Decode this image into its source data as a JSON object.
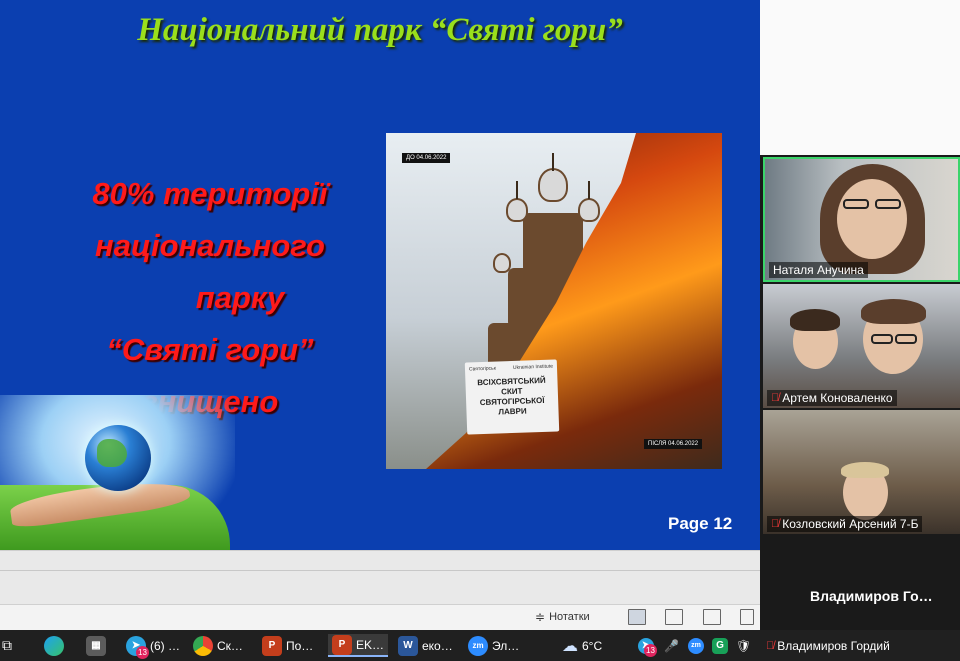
{
  "slide": {
    "title": "Національний парк “Святі гори”",
    "body_lines": [
      "80% території",
      "національного",
      "парку",
      "“Святі гори”",
      "знищено"
    ],
    "page_label": "Page 12",
    "picture": {
      "before_label": "ДО 04.06.2022",
      "after_label": "ПІСЛЯ 04.06.2022",
      "logo_left": "Святогірськ",
      "logo_right": "Ukrainian Institute",
      "caption_line1": "ВСІХСВЯТСЬКИЙ СКИТ",
      "caption_line2": "СВЯТОГІРСЬКОЇ ЛАВРИ"
    }
  },
  "ppt_status": {
    "notes_label": "Нотатки"
  },
  "zoom": {
    "participants": [
      {
        "name": "Наталя Анучина",
        "muted": false,
        "active_speaker": true
      },
      {
        "name": "Артем Коноваленко",
        "muted": true
      },
      {
        "name": "Козловский Арсений 7-Б",
        "muted": true
      }
    ],
    "name_only_tile": "Владимиров  Го…",
    "bottom_tile_name": "Владимиров Гордий"
  },
  "taskbar": {
    "items": [
      {
        "label": "(6) …",
        "badge": "13"
      },
      {
        "label": "Ск…"
      },
      {
        "label": "По…"
      },
      {
        "label": "EK…"
      },
      {
        "label": "еко…"
      },
      {
        "label": "Эл…"
      }
    ],
    "weather": "6°C",
    "tray_badge": "13"
  },
  "colors": {
    "slide_bg": "#0b3fb0",
    "title_color": "#9adf1c",
    "body_color": "#ff1a1a",
    "active_speaker_border": "#3bd46a"
  }
}
